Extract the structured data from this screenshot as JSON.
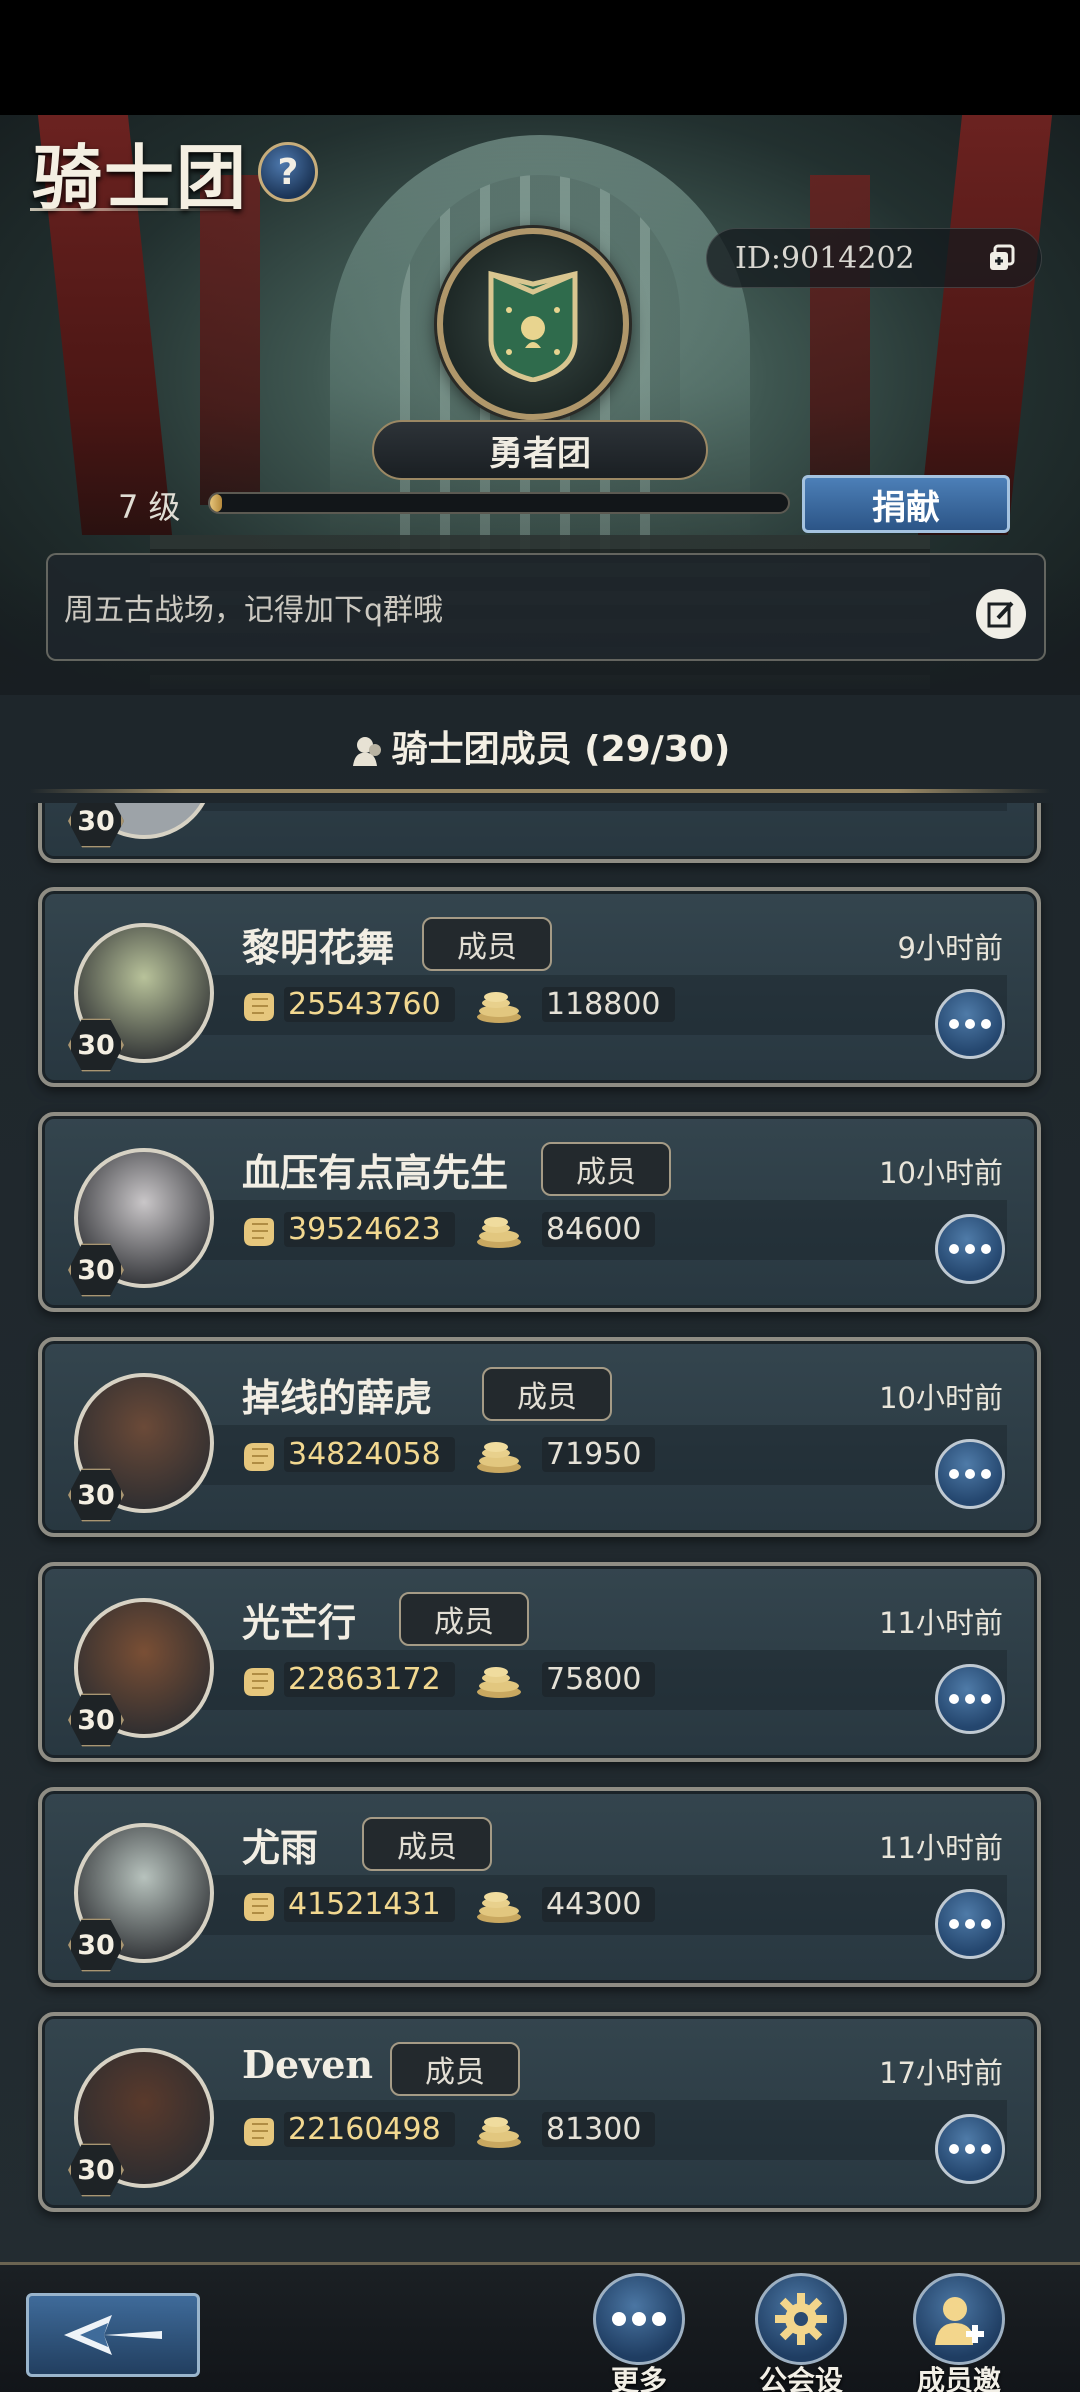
{
  "header": {
    "title": "骑士团",
    "help_label": "?",
    "guild_id": "ID:9014202",
    "guild_name": "勇者团",
    "level_text": "7 级",
    "level_progress": 0.02,
    "donate_label": "捐献",
    "notice": "周五古战场，记得加下q群哦"
  },
  "members_section": {
    "title": "骑士团成员 (29/30)"
  },
  "members": [
    {
      "name": "黎明花舞",
      "role": "成员",
      "last_online": "9小时前",
      "level": "30",
      "power": "25543760",
      "coins": "118800",
      "avatar_color": "#b8c29a"
    },
    {
      "name": "血压有点高先生",
      "role": "成员",
      "last_online": "10小时前",
      "level": "30",
      "power": "39524623",
      "coins": "84600",
      "avatar_color": "#c9c6c8"
    },
    {
      "name": "掉线的薛虎",
      "role": "成员",
      "last_online": "10小时前",
      "level": "30",
      "power": "34824058",
      "coins": "71950",
      "avatar_color": "#6b4a38"
    },
    {
      "name": "光芒行",
      "role": "成员",
      "last_online": "11小时前",
      "level": "30",
      "power": "22863172",
      "coins": "75800",
      "avatar_color": "#7a4f35"
    },
    {
      "name": "尤雨",
      "role": "成员",
      "last_online": "11小时前",
      "level": "30",
      "power": "41521431",
      "coins": "44300",
      "avatar_color": "#b7c2bd"
    },
    {
      "name": "Deven",
      "role": "成员",
      "last_online": "17小时前",
      "level": "30",
      "power": "22160498",
      "coins": "81300",
      "avatar_color": "#5a3a2c"
    }
  ],
  "bottom_bar": {
    "more_label": "更多",
    "settings_label": "公会设置",
    "invite_label": "成员邀请"
  },
  "colors": {
    "accent_gold": "#b0976a",
    "button_blue": "#2c5587",
    "power_text": "#f2d890"
  }
}
